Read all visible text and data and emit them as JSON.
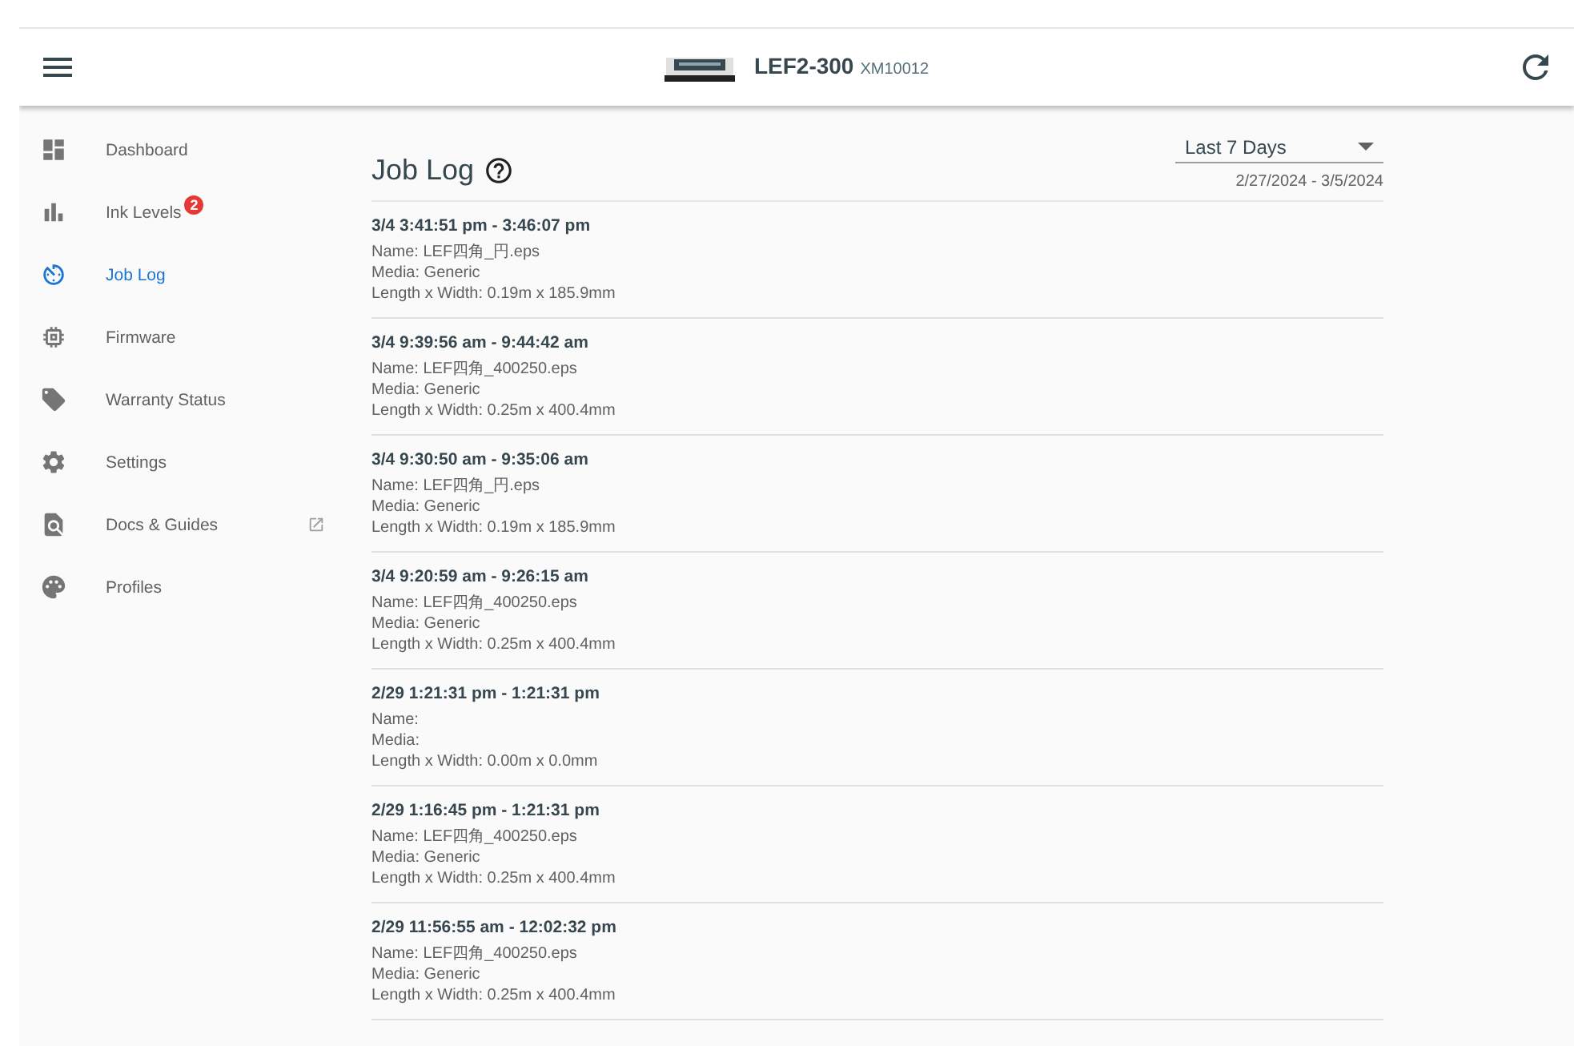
{
  "header": {
    "model": "LEF2-300",
    "serial": "XM10012"
  },
  "sidebar": {
    "items": [
      {
        "label": "Dashboard",
        "selected": false
      },
      {
        "label": "Ink Levels",
        "selected": false,
        "badge": "2"
      },
      {
        "label": "Job Log",
        "selected": true
      },
      {
        "label": "Firmware",
        "selected": false
      },
      {
        "label": "Warranty Status",
        "selected": false
      },
      {
        "label": "Settings",
        "selected": false
      },
      {
        "label": "Docs & Guides",
        "selected": false,
        "external": true
      },
      {
        "label": "Profiles",
        "selected": false
      }
    ]
  },
  "page": {
    "title": "Job Log",
    "range": {
      "value": "Last 7 Days",
      "dates": "2/27/2024 - 3/5/2024"
    }
  },
  "jobs": [
    {
      "time": "3/4 3:41:51 pm - 3:46:07 pm",
      "name": "Name: LEF四角_円.eps",
      "media": "Media: Generic",
      "size": "Length x Width: 0.19m x 185.9mm"
    },
    {
      "time": "3/4 9:39:56 am - 9:44:42 am",
      "name": "Name: LEF四角_400250.eps",
      "media": "Media: Generic",
      "size": "Length x Width: 0.25m x 400.4mm"
    },
    {
      "time": "3/4 9:30:50 am - 9:35:06 am",
      "name": "Name: LEF四角_円.eps",
      "media": "Media: Generic",
      "size": "Length x Width: 0.19m x 185.9mm"
    },
    {
      "time": "3/4 9:20:59 am - 9:26:15 am",
      "name": "Name: LEF四角_400250.eps",
      "media": "Media: Generic",
      "size": "Length x Width: 0.25m x 400.4mm"
    },
    {
      "time": "2/29 1:21:31 pm - 1:21:31 pm",
      "name": "Name:",
      "media": "Media:",
      "size": "Length x Width: 0.00m x 0.0mm"
    },
    {
      "time": "2/29 1:16:45 pm - 1:21:31 pm",
      "name": "Name: LEF四角_400250.eps",
      "media": "Media: Generic",
      "size": "Length x Width: 0.25m x 400.4mm"
    },
    {
      "time": "2/29 11:56:55 am - 12:02:32 pm",
      "name": "Name: LEF四角_400250.eps",
      "media": "Media: Generic",
      "size": "Length x Width: 0.25m x 400.4mm"
    }
  ]
}
